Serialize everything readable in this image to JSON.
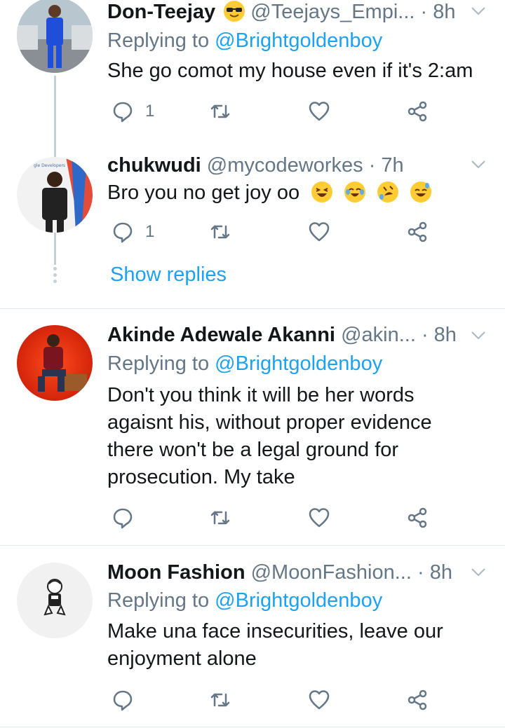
{
  "tweets": [
    {
      "name": "Don-Teejay",
      "handle": "@Teejays_Empi...",
      "time": "· 8h",
      "reply_prefix": "Replying to ",
      "reply_to": "@Brightgoldenboy",
      "text": "She go comot my house even if it's 2:am",
      "reply_count": "1",
      "retweet_count": "",
      "like_count": ""
    },
    {
      "name": "chukwudi",
      "handle": "@mycodeworkes",
      "time": "· 7h",
      "text": "Bro you no get joy oo",
      "reply_count": "1",
      "retweet_count": "",
      "like_count": ""
    },
    {
      "name": "Akinde Adewale Akanni",
      "handle": "@akin...",
      "time": "· 8h",
      "reply_prefix": "Replying to ",
      "reply_to": "@Brightgoldenboy",
      "text": "Don't you think it will be her words agaisnt his, without proper evidence there won't be a legal ground for prosecution. My take",
      "reply_count": "",
      "retweet_count": "",
      "like_count": ""
    },
    {
      "name": "Moon Fashion",
      "handle": "@MoonFashion...",
      "time": "· 8h",
      "reply_prefix": "Replying to ",
      "reply_to": "@Brightgoldenboy",
      "text": "Make una face insecurities, leave our enjoyment alone",
      "reply_count": "",
      "retweet_count": "",
      "like_count": ""
    }
  ],
  "thread": {
    "show_replies": "Show replies"
  },
  "icons": [
    "sunglasses-emoji-icon",
    "grinning-squinting-emoji-icon",
    "tears-of-joy-emoji-icon",
    "rolling-laughing-emoji-icon",
    "sweat-smile-emoji-icon",
    "reply-icon",
    "retweet-icon",
    "like-icon",
    "share-icon",
    "chevron-down-icon"
  ],
  "colors": {
    "accent": "#1da1f2",
    "secondary_text": "#657786",
    "icon": "#657786",
    "thread_line": "#c4cfd6",
    "separator": "#e1e8ed"
  }
}
